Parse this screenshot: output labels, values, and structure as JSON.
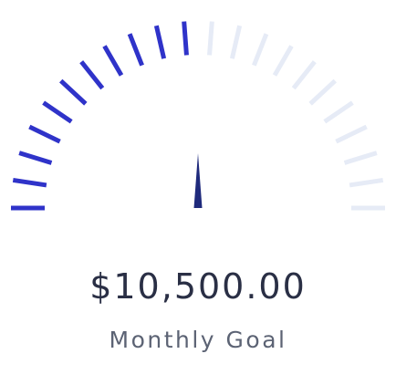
{
  "gauge": {
    "progress": 0.5,
    "tick_count": 22,
    "active_color": "#2f33c9",
    "inactive_color": "#e6ebf6",
    "needle_color": "#1f2a7c"
  },
  "amount": "$10,500.00",
  "label": "Monthly Goal"
}
